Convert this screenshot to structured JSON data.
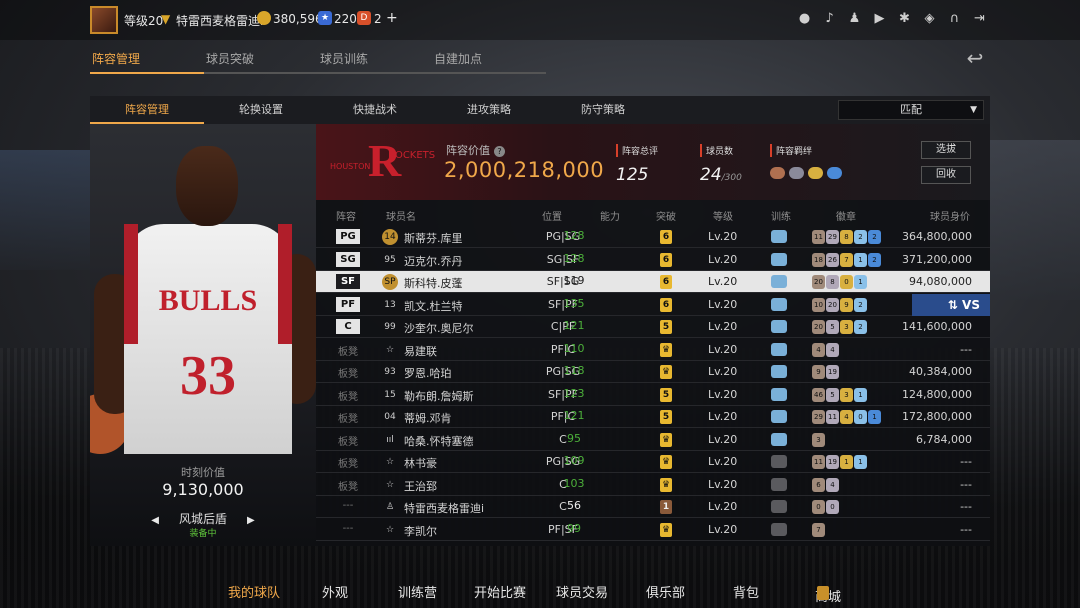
{
  "topbar": {
    "level": "等级20",
    "team_name": "特雷西麦格雷迪i",
    "coins": "380,596",
    "stars": "220",
    "tickets": "2",
    "plus": "+",
    "icons": [
      "user-icon",
      "bell-icon",
      "friends-icon",
      "video-icon",
      "settings-icon",
      "shield-icon",
      "headset-icon",
      "exit-icon"
    ]
  },
  "main_tabs": [
    "阵容管理",
    "球员突破",
    "球员训练",
    "自建加点"
  ],
  "sub_tabs": [
    "阵容管理",
    "轮换设置",
    "快捷战术",
    "进攻策略",
    "防守策略"
  ],
  "dropdown": {
    "value": "匹配"
  },
  "player_card": {
    "jersey_text": "BULLS",
    "jersey_number": "33",
    "current_value_label": "时刻价值",
    "current_value": "9,130,000",
    "skin_name": "风城后盾",
    "skin_status": "装备中"
  },
  "team_info": {
    "logo_text": "ROCKETS",
    "logo_city": "HOUSTON",
    "value_label": "阵容价值",
    "value": "2,000,218,000",
    "rating_label": "阵容总评",
    "rating": "125",
    "count_label": "球员数",
    "count": "24",
    "count_max": "/300",
    "bond_label": "阵容羁绊",
    "select_btn": "选拔",
    "recycle_btn": "回收"
  },
  "table": {
    "headers": [
      "阵容",
      "球员名",
      "位置",
      "能力",
      "突破",
      "等级",
      "训练",
      "徽章",
      "球员身价"
    ],
    "rows": [
      {
        "slot": "PG",
        "starter": true,
        "num": "14",
        "num_badge": true,
        "name": "斯蒂芬.库里",
        "pos": "PG|SG",
        "ability": "128",
        "breakthrough": "6",
        "bt_style": "gold",
        "level": "Lv.20",
        "training": true,
        "badges": [
          "11",
          "29",
          "8",
          "2",
          "2"
        ],
        "salary": "364,800,000",
        "selected": false
      },
      {
        "slot": "SG",
        "starter": true,
        "num": "95",
        "num_badge": false,
        "name": "迈克尔.乔丹",
        "pos": "SG|SF",
        "ability": "128",
        "breakthrough": "6",
        "bt_style": "gold",
        "level": "Lv.20",
        "training": true,
        "badges": [
          "18",
          "26",
          "7",
          "1",
          "2"
        ],
        "salary": "371,200,000",
        "selected": false
      },
      {
        "slot": "SF",
        "starter": true,
        "num": "SP",
        "num_badge": true,
        "name": "斯科特.皮蓬",
        "pos": "SF|SG",
        "ability": "119",
        "breakthrough": "6",
        "bt_style": "gold",
        "level": "Lv.20",
        "training": true,
        "badges": [
          "20",
          "8",
          "0",
          "1"
        ],
        "salary": "94,080,000",
        "selected": true
      },
      {
        "slot": "PF",
        "starter": true,
        "num": "13",
        "num_badge": false,
        "name": "凯文.杜兰特",
        "pos": "SF|PF",
        "ability": "135",
        "breakthrough": "6",
        "bt_style": "gold",
        "level": "Lv.20",
        "training": true,
        "badges": [
          "10",
          "20",
          "9",
          "2"
        ],
        "salary": "",
        "selected": false,
        "vs": true
      },
      {
        "slot": "C",
        "starter": true,
        "num": "99",
        "num_badge": false,
        "name": "沙奎尔.奥尼尔",
        "pos": "C|PF",
        "ability": "121",
        "breakthrough": "5",
        "bt_style": "gold",
        "level": "Lv.20",
        "training": true,
        "badges": [
          "20",
          "5",
          "3",
          "2"
        ],
        "salary": "141,600,000",
        "selected": false
      },
      {
        "slot": "板凳",
        "starter": false,
        "num": "☆",
        "num_badge": false,
        "name": "易建联",
        "pos": "PF|C",
        "ability": "110",
        "breakthrough": "♛",
        "bt_style": "gold",
        "level": "Lv.20",
        "training": true,
        "badges": [
          "4",
          "4"
        ],
        "salary": "---",
        "selected": false
      },
      {
        "slot": "板凳",
        "starter": false,
        "num": "93",
        "num_badge": false,
        "name": "罗恩.哈珀",
        "pos": "PG|SG",
        "ability": "118",
        "breakthrough": "♛",
        "bt_style": "gold",
        "level": "Lv.20",
        "training": true,
        "badges": [
          "9",
          "19"
        ],
        "salary": "40,384,000",
        "selected": false
      },
      {
        "slot": "板凳",
        "starter": false,
        "num": "15",
        "num_badge": false,
        "name": "勒布朗.詹姆斯",
        "pos": "SF|PF",
        "ability": "123",
        "breakthrough": "5",
        "bt_style": "gold",
        "level": "Lv.20",
        "training": true,
        "badges": [
          "46",
          "5",
          "3",
          "1"
        ],
        "salary": "124,800,000",
        "selected": false
      },
      {
        "slot": "板凳",
        "starter": false,
        "num": "04",
        "num_badge": false,
        "name": "蒂姆.邓肯",
        "pos": "PF|C",
        "ability": "121",
        "breakthrough": "5",
        "bt_style": "gold",
        "level": "Lv.20",
        "training": true,
        "badges": [
          "29",
          "11",
          "4",
          "0",
          "1"
        ],
        "salary": "172,800,000",
        "selected": false
      },
      {
        "slot": "板凳",
        "starter": false,
        "num": "ııl",
        "num_badge": false,
        "name": "哈桑.怀特塞德",
        "pos": "C",
        "ability": "95",
        "breakthrough": "♛",
        "bt_style": "gold",
        "level": "Lv.20",
        "training": true,
        "badges": [
          "3"
        ],
        "salary": "6,784,000",
        "selected": false
      },
      {
        "slot": "板凳",
        "starter": false,
        "num": "☆",
        "num_badge": false,
        "name": "林书豪",
        "pos": "PG|SG",
        "ability": "109",
        "breakthrough": "♛",
        "bt_style": "gold",
        "level": "Lv.20",
        "training": false,
        "badges": [
          "11",
          "19",
          "1",
          "1"
        ],
        "salary": "---",
        "selected": false
      },
      {
        "slot": "板凳",
        "starter": false,
        "num": "☆",
        "num_badge": false,
        "name": "王治郅",
        "pos": "C",
        "ability": "103",
        "breakthrough": "♛",
        "bt_style": "gold",
        "level": "Lv.20",
        "training": false,
        "badges": [
          "6",
          "4"
        ],
        "salary": "---",
        "selected": false
      },
      {
        "slot": "---",
        "starter": false,
        "num": "♙",
        "num_badge": false,
        "name": "特雷西麦格雷迪i",
        "pos": "C",
        "ability": "56",
        "breakthrough": "1",
        "bt_style": "bronze",
        "level": "Lv.20",
        "training": false,
        "badges": [
          "0",
          "0"
        ],
        "salary": "---",
        "selected": false,
        "ability_white": true
      },
      {
        "slot": "---",
        "starter": false,
        "num": "☆",
        "num_badge": false,
        "name": "李凯尔",
        "pos": "PF|SF",
        "ability": "99",
        "breakthrough": "♛",
        "bt_style": "gold",
        "level": "Lv.20",
        "training": false,
        "badges": [
          "7"
        ],
        "salary": "---",
        "selected": false
      }
    ]
  },
  "bottom_nav": [
    "我的球队",
    "外观",
    "训练营",
    "开始比赛",
    "球员交易",
    "俱乐部",
    "背包",
    "商城"
  ],
  "colors": {
    "accent": "#f0a84a",
    "ability_green": "#4caf3a",
    "rockets_red": "#c8202c"
  }
}
